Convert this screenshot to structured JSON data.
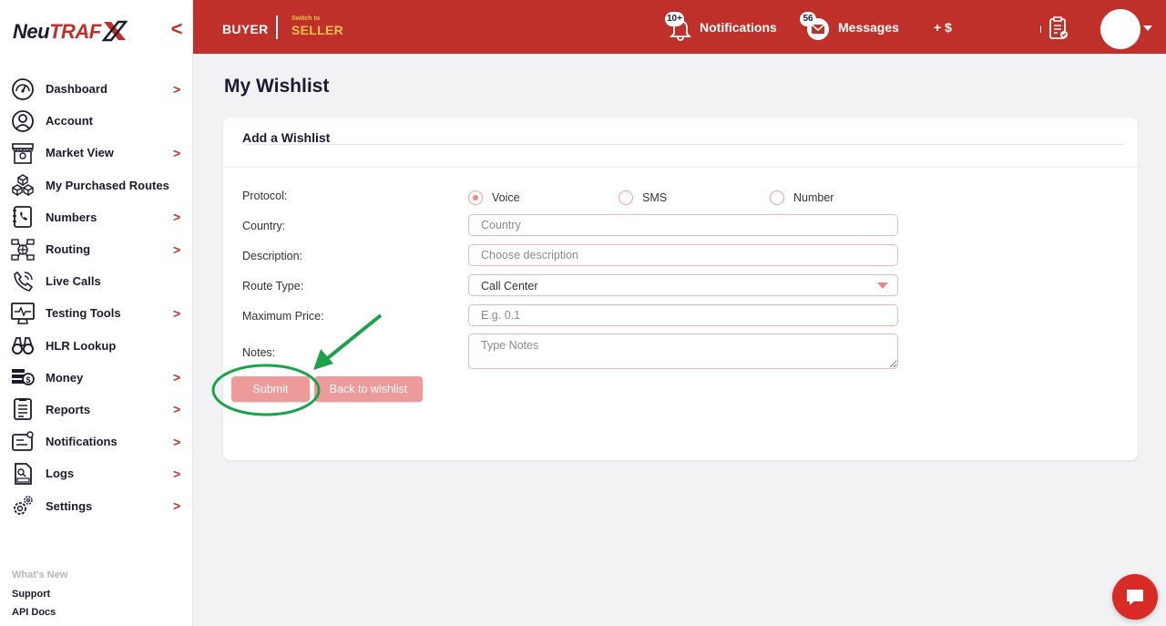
{
  "app": {
    "logo_main": "Neu",
    "logo_accent": "TRAF",
    "collapse_glyph": "<"
  },
  "sidebar": {
    "items": [
      {
        "label": "Dashboard",
        "icon": "speedometer-icon",
        "has_arrow": true
      },
      {
        "label": "Account",
        "icon": "user-icon",
        "has_arrow": false
      },
      {
        "label": "Market View",
        "icon": "storefront-icon",
        "has_arrow": true
      },
      {
        "label": "My Purchased Routes",
        "icon": "cubes-icon",
        "has_arrow": false
      },
      {
        "label": "Numbers",
        "icon": "phone-book-icon",
        "has_arrow": true
      },
      {
        "label": "Routing",
        "icon": "network-icon",
        "has_arrow": true
      },
      {
        "label": "Live Calls",
        "icon": "phone-call-icon",
        "has_arrow": false
      },
      {
        "label": "Testing Tools",
        "icon": "monitor-pulse-icon",
        "has_arrow": true
      },
      {
        "label": "HLR Lookup",
        "icon": "binoculars-icon",
        "has_arrow": false
      },
      {
        "label": "Money",
        "icon": "money-icon",
        "has_arrow": true
      },
      {
        "label": "Reports",
        "icon": "report-icon",
        "has_arrow": true
      },
      {
        "label": "Notifications",
        "icon": "notification-card-icon",
        "has_arrow": true
      },
      {
        "label": "Logs",
        "icon": "logs-icon",
        "has_arrow": true
      },
      {
        "label": "Settings",
        "icon": "gears-icon",
        "has_arrow": true
      }
    ],
    "arrow_glyph": ">",
    "footer_links": [
      "What's New",
      "Support",
      "API Docs"
    ]
  },
  "topbar": {
    "role": "BUYER",
    "switch_small": "Switch to",
    "switch_big": "SELLER",
    "notifications_label": "Notifications",
    "notifications_badge": "10+",
    "messages_label": "Messages",
    "messages_badge": "56",
    "plus_dollar": "+ $"
  },
  "page": {
    "title": "My Wishlist"
  },
  "form": {
    "card_title": "Add a Wishlist",
    "protocol_label": "Protocol:",
    "protocol_options": [
      "Voice",
      "SMS",
      "Number"
    ],
    "protocol_selected": "Voice",
    "country_label": "Country:",
    "country_placeholder": "Country",
    "description_label": "Description:",
    "description_placeholder": "Choose description",
    "route_type_label": "Route Type:",
    "route_type_value": "Call Center",
    "max_price_label": "Maximum Price:",
    "max_price_placeholder": "E.g. 0.1",
    "notes_label": "Notes:",
    "notes_placeholder": "Type Notes",
    "submit_label": "Submit",
    "back_label": "Back to wishlist"
  },
  "colors": {
    "brand_red": "#c0302a",
    "switch_gold": "#f2c14e",
    "button_pink": "#ec9a9a",
    "annotation_green": "#1aa34a"
  }
}
